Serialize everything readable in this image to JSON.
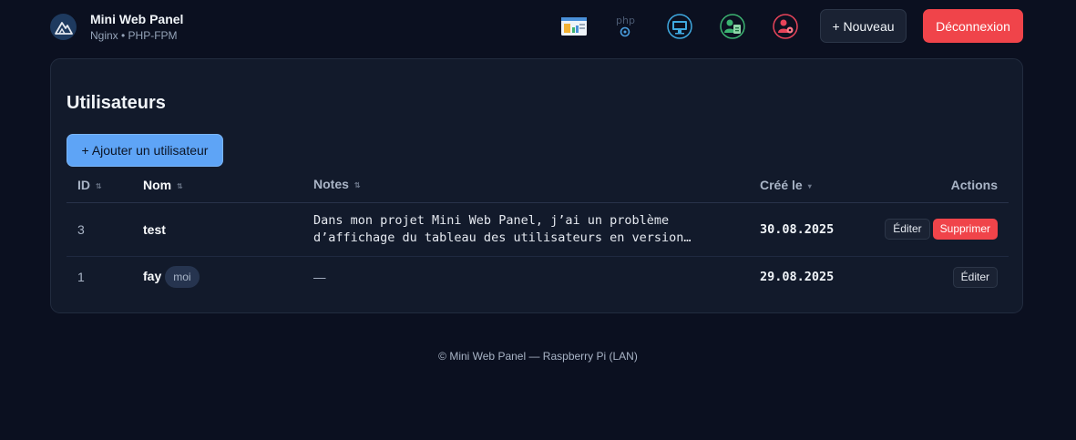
{
  "brand": {
    "title": "Mini Web Panel",
    "subtitle": "Nginx • PHP-FPM",
    "logo_icon": "mountain-logo-icon"
  },
  "nav_icons": [
    {
      "name": "dashboard-icon"
    },
    {
      "name": "php-settings-icon",
      "text": "php"
    },
    {
      "name": "monitor-icon"
    },
    {
      "name": "user-list-icon"
    },
    {
      "name": "user-settings-icon"
    }
  ],
  "header": {
    "new_label": "+ Nouveau",
    "logout_label": "Déconnexion"
  },
  "page": {
    "title": "Utilisateurs",
    "add_user_label": "+ Ajouter un utilisateur"
  },
  "table": {
    "columns": [
      "ID",
      "Nom",
      "Notes",
      "Créé le",
      "Actions"
    ],
    "rows": [
      {
        "id": "3",
        "nom": "test",
        "notes": "Dans mon projet Mini Web Panel, j’ai un problème d’affichage du tableau des utilisateurs en version…",
        "cree_le": "30.08.2025",
        "edit_label": "Éditer",
        "delete_label": "Supprimer"
      },
      {
        "id": "1",
        "nom": "fay",
        "badge": "moi",
        "notes": "—",
        "cree_le": "29.08.2025",
        "edit_label": "Éditer"
      }
    ]
  },
  "footer": {
    "text": "© Mini Web Panel — Raspberry Pi (LAN)"
  },
  "colors": {
    "background": "#0b1020",
    "card": "#121a2b",
    "primary": "#5ea4f6",
    "danger": "#f0444a"
  }
}
